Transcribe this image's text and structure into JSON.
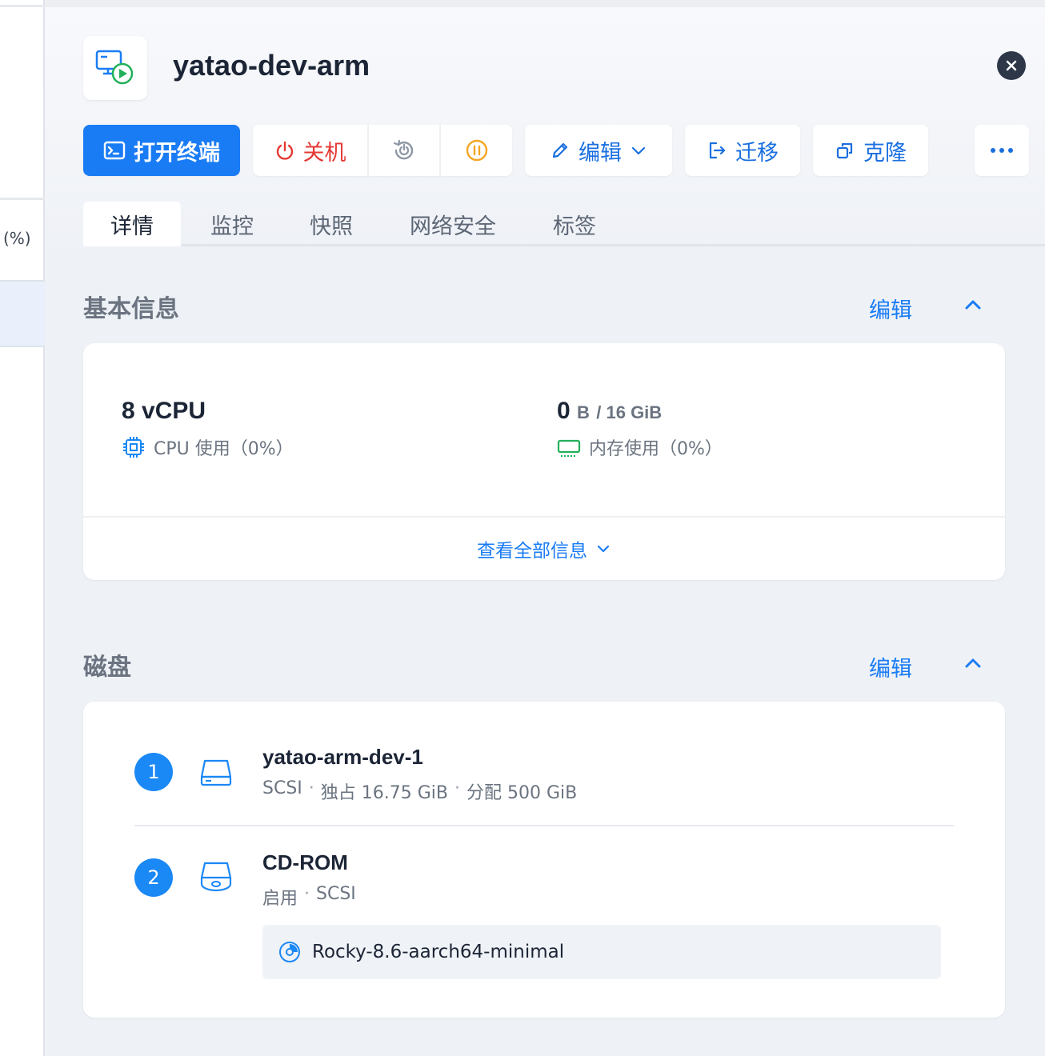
{
  "left_panel": {
    "column_header_fragment": "(%)"
  },
  "header": {
    "title": "yatao-dev-arm",
    "app_icon": "vm-running-icon",
    "close_icon": "close-icon"
  },
  "toolbar": {
    "open_terminal": "打开终端",
    "shutdown": "关机",
    "restart_icon": "restart-icon",
    "pause_icon": "pause-icon",
    "edit": "编辑",
    "migrate": "迁移",
    "clone": "克隆",
    "more_icon": "more-icon"
  },
  "tabs": [
    {
      "label": "详情",
      "active": true
    },
    {
      "label": "监控",
      "active": false
    },
    {
      "label": "快照",
      "active": false
    },
    {
      "label": "网络安全",
      "active": false
    },
    {
      "label": "标签",
      "active": false
    }
  ],
  "basic_info": {
    "title": "基本信息",
    "edit_label": "编辑",
    "cpu": {
      "value": "8 vCPU",
      "caption": "CPU 使用（0%）"
    },
    "memory": {
      "value": "0",
      "unit": "B",
      "total": "/ 16 GiB",
      "caption": "内存使用（0%）"
    },
    "view_all": "查看全部信息"
  },
  "disks": {
    "title": "磁盘",
    "edit_label": "编辑",
    "items": [
      {
        "index": "1",
        "name": "yatao-arm-dev-1",
        "bus": "SCSI",
        "exclusive": "独占 16.75 GiB",
        "allocated": "分配 500 GiB"
      },
      {
        "index": "2",
        "name": "CD-ROM",
        "status": "启用",
        "bus": "SCSI",
        "iso": "Rocky-8.6-aarch64-minimal"
      }
    ]
  },
  "colors": {
    "primary": "#1a7cf5",
    "danger": "#e53935",
    "warning": "#f5a623",
    "success": "#22b05a",
    "disk_badge": "#1a88f5"
  }
}
